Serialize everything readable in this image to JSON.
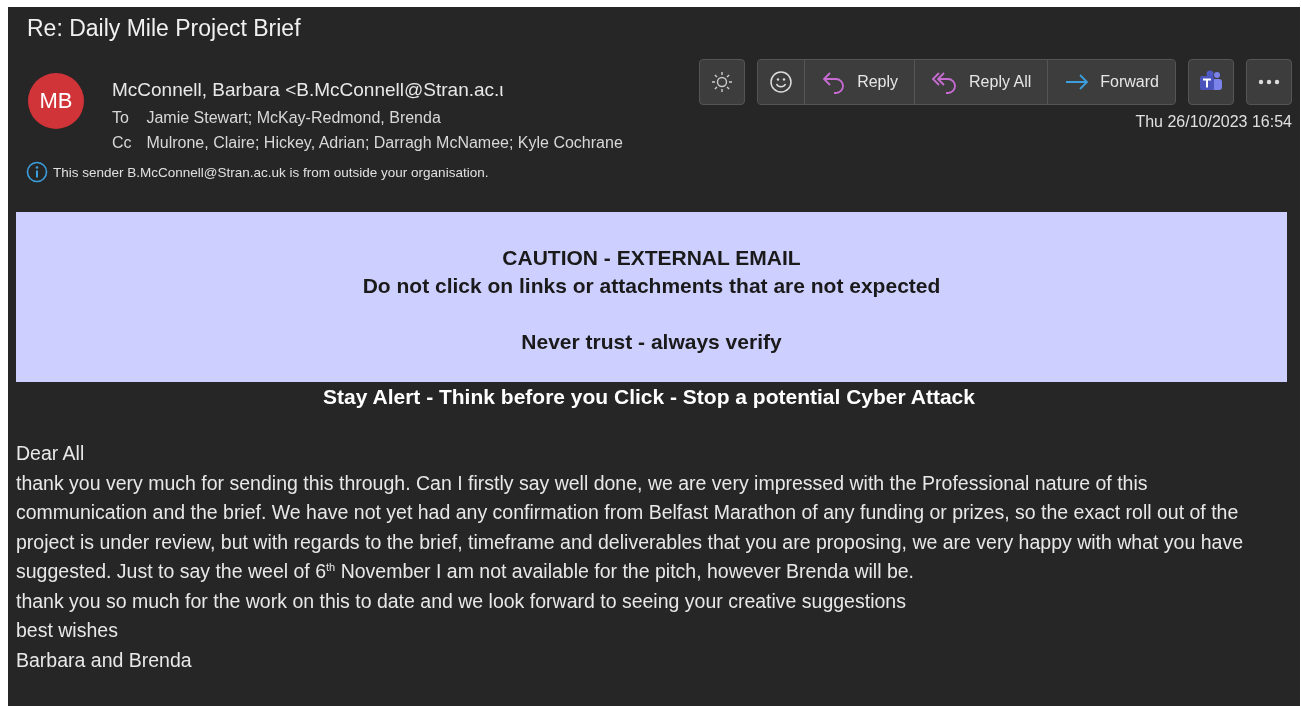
{
  "window": {
    "title": "Re: Daily Mile Project Brief"
  },
  "sender": {
    "initials": "MB",
    "name": "McConnell, Barbara <B.McConnell@Stran.ac.ι"
  },
  "recipients": [
    {
      "label": "To",
      "value": "Jamie Stewart; McKay-Redmond, Brenda"
    },
    {
      "label": "Cc",
      "value": "Mulrone, Claire; Hickey, Adrian; Darragh McNamee; Kyle Cochrane"
    }
  ],
  "notice": "This sender B.McConnell@Stran.ac.uk is from outside your organisation.",
  "actions": [
    {
      "kind": "reply",
      "label": "Reply"
    },
    {
      "kind": "reply-all",
      "label": "Reply All"
    },
    {
      "kind": "forward",
      "label": "Forward"
    }
  ],
  "date": "Thu 26/10/2023 16:54",
  "banner": {
    "lines": [
      "CAUTION - EXTERNAL EMAIL",
      "Do not click on links or attachments that are not expected",
      "Never trust - always verify"
    ]
  },
  "slogan": "Stay Alert - Think before you Click - Stop a potential Cyber Attack",
  "body": [
    "Dear All",
    "thank you very much for sending this through. Can I firstly say well done, we are very impressed with the Professional nature of this communication and the brief. We have not yet had any confirmation from Belfast Marathon of any funding or prizes, so the exact roll out of the project is under review, but with regards to the brief,  timeframe and deliverables that you are proposing, we are very happy with what you have suggested. Just to say the weel of 6$^{th}$ November I am not available for the pitch, however Brenda will be.",
    "thank you so much for the work on this to date and we look forward to seeing your creative suggestions",
    "best wishes",
    "Barbara and Brenda"
  ]
}
